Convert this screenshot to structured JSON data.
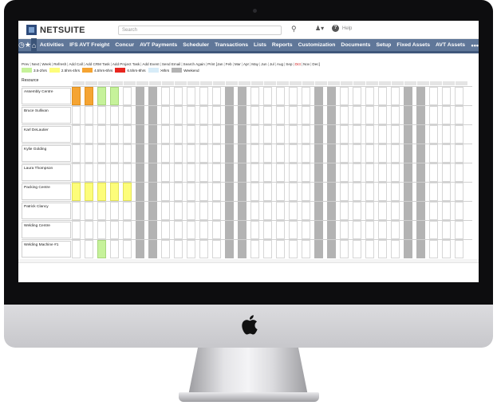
{
  "brand": {
    "name": "NETSUITE"
  },
  "search": {
    "placeholder": "Search"
  },
  "help": {
    "label": "Help"
  },
  "nav": {
    "items": [
      "Activities",
      "IFS AVT Freight",
      "Concur",
      "AVT Payments",
      "Scheduler",
      "Transactions",
      "Lists",
      "Reports",
      "Customization",
      "Documents",
      "Setup",
      "Fixed Assets",
      "AVT Assets"
    ],
    "more": "•••"
  },
  "toolbar": {
    "links": [
      "Prev",
      "Next",
      "Week",
      "Refresh",
      "Add Call",
      "Add CRM Task",
      "Add Project Task",
      "Add Event",
      "Send Email",
      "Search Again",
      "Print"
    ],
    "months": [
      "[Jan",
      "Feb",
      "Mar",
      "Apr",
      "May",
      "Jun",
      "Jul",
      "Aug",
      "Sep",
      "Oct",
      "Nov",
      "Dec]"
    ],
    "current_month": "Oct"
  },
  "legend": [
    {
      "label": "3.5-2hrs",
      "color": "#c6f29a"
    },
    {
      "label": "2.5hrs-4hrs",
      "color": "#fdfd7a"
    },
    {
      "label": "4.5hrs-6hrs",
      "color": "#f5a432"
    },
    {
      "label": "6.5hrs-8hrs",
      "color": "#e8261f"
    },
    {
      "label": ">8hrs",
      "color": "#d7ecf8"
    },
    {
      "label": "Weekend",
      "color": "#b3b3b3"
    }
  ],
  "resource_header": "Resource",
  "resources": [
    {
      "name": "Assembly Centre",
      "cells": "oogg"
    },
    {
      "name": "Bruce Sullivan",
      "cells": ""
    },
    {
      "name": "Karl DeLautier",
      "cells": ""
    },
    {
      "name": "Kylie Golding",
      "cells": ""
    },
    {
      "name": "Laura Thompson",
      "cells": ""
    },
    {
      "name": "Packing Centre",
      "cells": "yyyyy"
    },
    {
      "name": "Patrick Clancy",
      "cells": ""
    },
    {
      "name": "Welding Centre",
      "cells": ""
    },
    {
      "name": "Welding Machine #1",
      "cells": "  g"
    }
  ],
  "weekend_columns": [
    5,
    6,
    12,
    13,
    19,
    20,
    26,
    27
  ],
  "day_count": 31
}
